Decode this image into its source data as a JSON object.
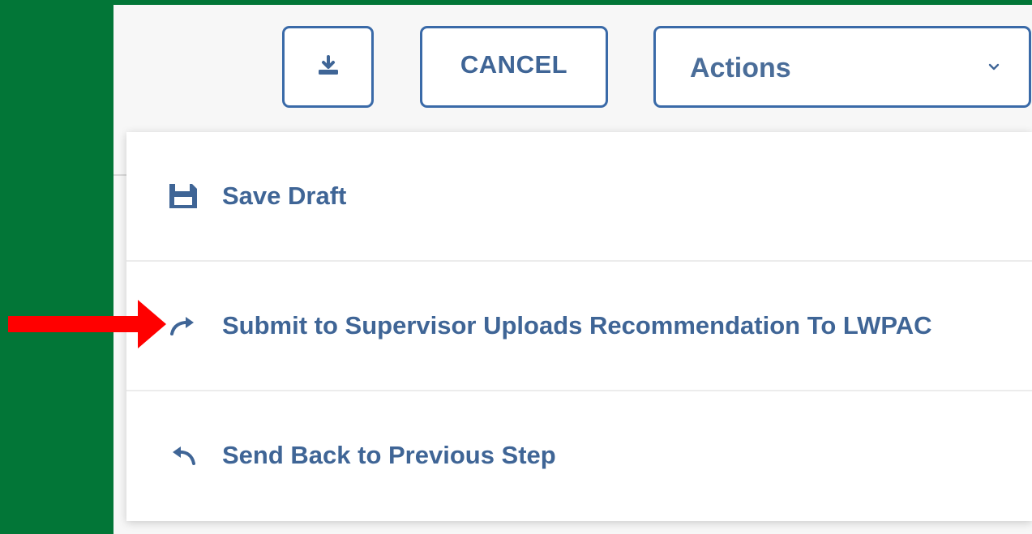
{
  "toolbar": {
    "download_icon": "download-icon",
    "cancel_label": "CANCEL",
    "actions_label": "Actions",
    "actions_chevron_icon": "chevron-down-icon"
  },
  "menu": {
    "items": [
      {
        "label": "Save Draft",
        "icon": "floppy-disk-icon"
      },
      {
        "label": "Submit to Supervisor Uploads Recommendation To LWPAC",
        "icon": "redo-arrow-icon"
      },
      {
        "label": "Send Back to Previous Step",
        "icon": "undo-arrow-icon"
      }
    ]
  },
  "colors": {
    "background_green": "#027637",
    "panel": "#f7f7f7",
    "button_border": "#3a6aa8",
    "text_blue": "#3f6596",
    "annotation_arrow": "#ff0000"
  },
  "annotation": {
    "icon": "red-arrow-icon"
  }
}
